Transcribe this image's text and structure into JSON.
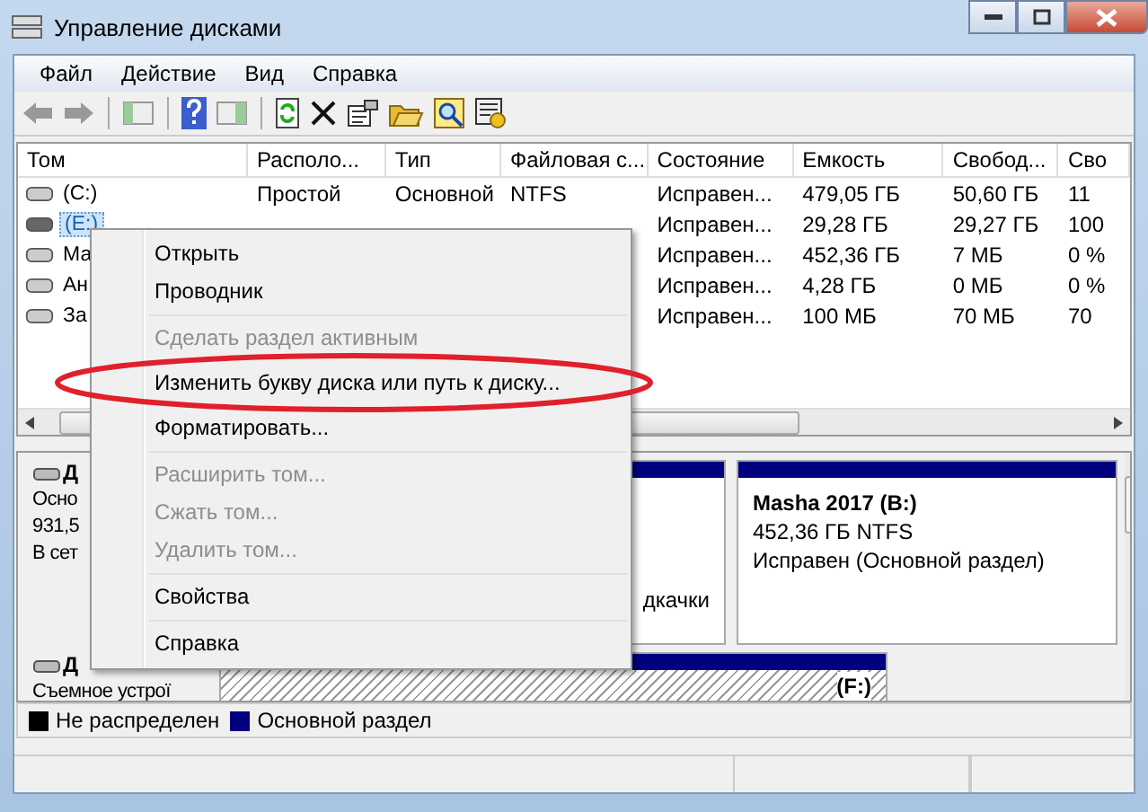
{
  "window": {
    "title": "Управление дисками"
  },
  "menu_bar": [
    "Файл",
    "Действие",
    "Вид",
    "Справка"
  ],
  "table": {
    "columns": [
      "Том",
      "Располо...",
      "Тип",
      "Файловая с...",
      "Состояние",
      "Емкость",
      "Свобод...",
      "Сво"
    ],
    "rows": [
      {
        "selected": false,
        "cells": [
          "(C:)",
          "Простой",
          "Основной",
          "NTFS",
          "Исправен...",
          "479,05 ГБ",
          "50,60 ГБ",
          "11"
        ]
      },
      {
        "selected": true,
        "cells": [
          "(E:)",
          "",
          "",
          "",
          "Исправен...",
          "29,28 ГБ",
          "29,27 ГБ",
          "100"
        ]
      },
      {
        "selected": false,
        "cells": [
          "Ма",
          "",
          "",
          "",
          "Исправен...",
          "452,36 ГБ",
          "7 МБ",
          "0 %"
        ]
      },
      {
        "selected": false,
        "cells": [
          "Ан",
          "",
          "",
          "",
          "Исправен...",
          "4,28 ГБ",
          "0 МБ",
          "0 %"
        ]
      },
      {
        "selected": false,
        "cells": [
          "За",
          "",
          "",
          "",
          "Исправен...",
          "100 МБ",
          "70 МБ",
          "70"
        ]
      }
    ]
  },
  "disks": [
    {
      "name": "Д",
      "lines": [
        "Осно",
        "931,5",
        "В сет"
      ],
      "partitions": [
        {
          "kind": "primary",
          "lines": [
            "дкачки"
          ]
        },
        {
          "kind": "primary",
          "title": "Masha 2017  (B:)",
          "lines": [
            "452,36 ГБ NTFS",
            "Исправен (Основной раздел)"
          ]
        }
      ]
    },
    {
      "name": "Д",
      "lines": [
        "Съемное устрої"
      ],
      "partitions": [
        {
          "kind": "hatched",
          "title": "(F:)"
        }
      ]
    }
  ],
  "legend": [
    {
      "label": "Не распределен",
      "color": "#000000"
    },
    {
      "label": "Основной раздел",
      "color": "#000080"
    }
  ],
  "context_menu": [
    {
      "kind": "item",
      "label": "Открыть",
      "disabled": false
    },
    {
      "kind": "item",
      "label": "Проводник",
      "disabled": false
    },
    {
      "kind": "separator"
    },
    {
      "kind": "item",
      "label": "Сделать раздел активным",
      "disabled": true
    },
    {
      "kind": "item",
      "label": "Изменить букву диска или путь к диску...",
      "disabled": false
    },
    {
      "kind": "item",
      "label": "Форматировать...",
      "disabled": false
    },
    {
      "kind": "separator"
    },
    {
      "kind": "item",
      "label": "Расширить том...",
      "disabled": true
    },
    {
      "kind": "item",
      "label": "Сжать том...",
      "disabled": true
    },
    {
      "kind": "item",
      "label": "Удалить том...",
      "disabled": true
    },
    {
      "kind": "separator"
    },
    {
      "kind": "item",
      "label": "Свойства",
      "disabled": false
    },
    {
      "kind": "separator"
    },
    {
      "kind": "item",
      "label": "Справка",
      "disabled": false
    }
  ]
}
